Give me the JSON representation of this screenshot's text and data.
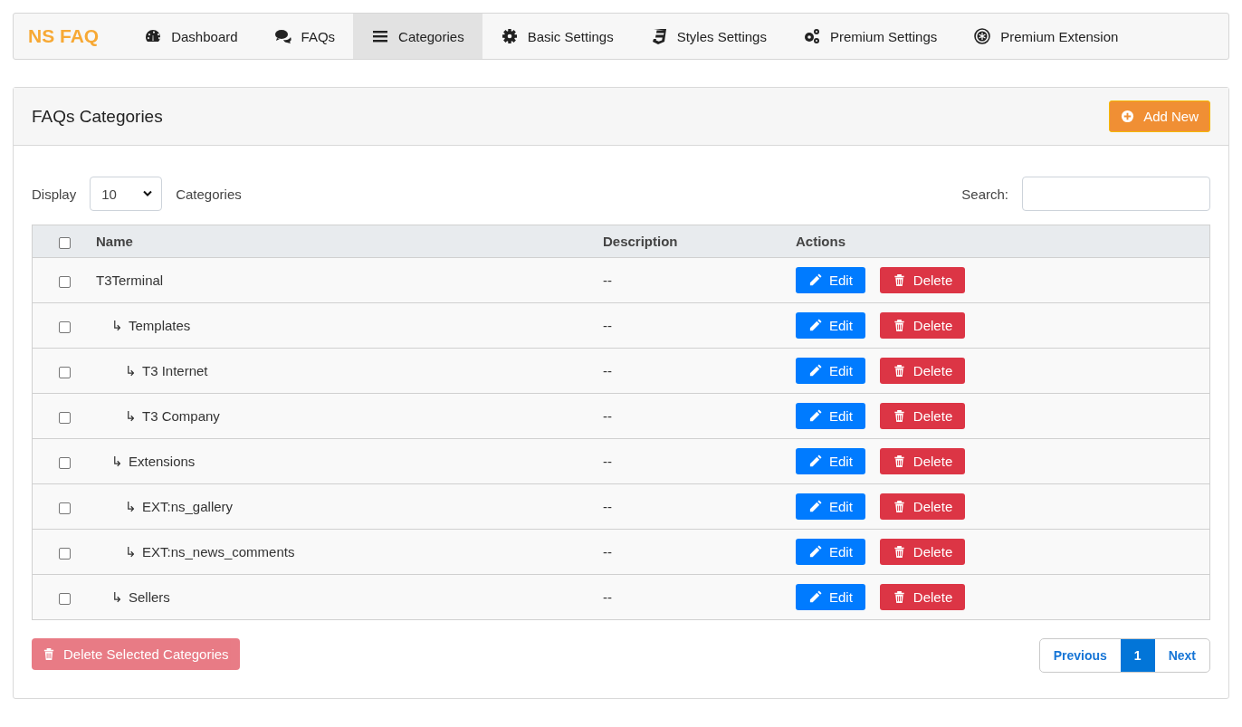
{
  "navbar": {
    "brand": "NS FAQ",
    "tabs": [
      {
        "label": "Dashboard",
        "selected": false
      },
      {
        "label": "FAQs",
        "selected": false
      },
      {
        "label": "Categories",
        "selected": true
      },
      {
        "label": "Basic Settings",
        "selected": false
      },
      {
        "label": "Styles Settings",
        "selected": false
      },
      {
        "label": "Premium Settings",
        "selected": false
      },
      {
        "label": "Premium Extension",
        "selected": false
      }
    ]
  },
  "card": {
    "title": "FAQs Categories",
    "add_button": "Add New",
    "length": {
      "label_before": "Display",
      "value": "10",
      "label_after": "Categories"
    },
    "search": {
      "label": "Search:"
    },
    "table": {
      "columns": [
        "Name",
        "Description",
        "Actions"
      ],
      "header_checked": false,
      "rows": [
        {
          "name": "T3Terminal",
          "description": "--",
          "checked": false,
          "edit": "Edit",
          "delete": "Delete",
          "children": [
            {
              "marker": "↳",
              "name": "Templates",
              "description": "--",
              "checked": false,
              "edit": "Edit",
              "delete": "Delete",
              "children": [
                {
                  "marker": "↳",
                  "name": "T3 Internet",
                  "description": "--",
                  "checked": false,
                  "edit": "Edit",
                  "delete": "Delete"
                },
                {
                  "marker": "↳",
                  "name": "T3 Company",
                  "description": "--",
                  "checked": false,
                  "edit": "Edit",
                  "delete": "Delete"
                }
              ]
            },
            {
              "marker": "↳",
              "name": "Extensions",
              "description": "--",
              "checked": false,
              "edit": "Edit",
              "delete": "Delete",
              "children": [
                {
                  "marker": "↳",
                  "name": "EXT:ns_gallery",
                  "description": "--",
                  "checked": false,
                  "edit": "Edit",
                  "delete": "Delete"
                },
                {
                  "marker": "↳",
                  "name": "EXT:ns_news_comments",
                  "description": "--",
                  "checked": false,
                  "edit": "Edit",
                  "delete": "Delete"
                }
              ]
            },
            {
              "marker": "↳",
              "name": "Sellers",
              "description": "--",
              "checked": false,
              "edit": "Edit",
              "delete": "Delete"
            }
          ]
        }
      ]
    },
    "bulk_delete": {
      "label": "Delete Selected Categories",
      "disabled": true
    },
    "pagination": [
      {
        "label": "Previous",
        "selected": false
      },
      {
        "label": "1",
        "selected": true
      },
      {
        "label": "Next",
        "selected": false
      }
    ]
  }
}
